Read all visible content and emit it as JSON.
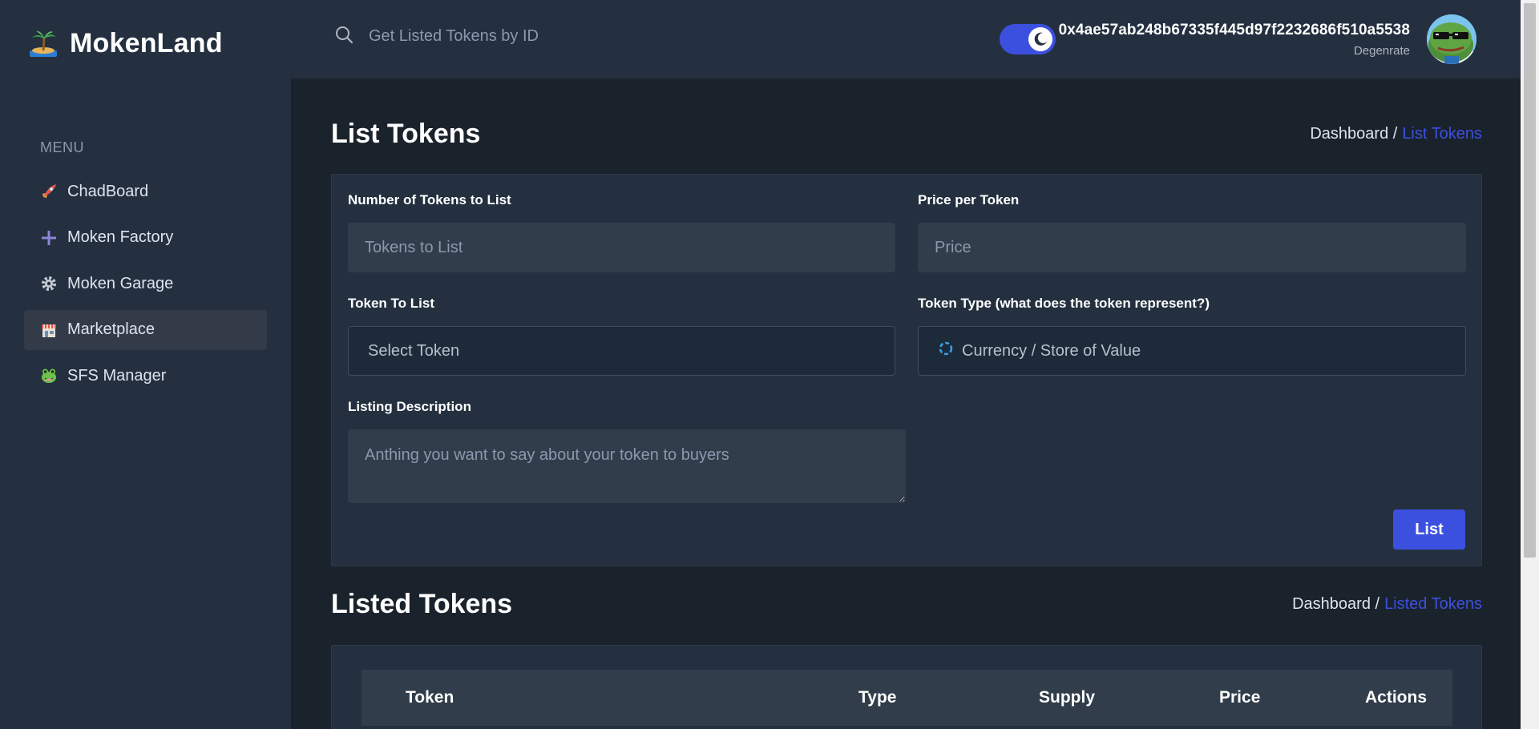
{
  "app": {
    "name": "MokenLand"
  },
  "sidebar": {
    "menu_title": "MENU",
    "items": [
      {
        "label": "ChadBoard",
        "icon": "rocket-icon",
        "active": false
      },
      {
        "label": "Moken Factory",
        "icon": "plus-icon",
        "active": false
      },
      {
        "label": "Moken Garage",
        "icon": "gear-icon",
        "active": false
      },
      {
        "label": "Marketplace",
        "icon": "shop-icon",
        "active": true
      },
      {
        "label": "SFS Manager",
        "icon": "frog-icon",
        "active": false
      }
    ]
  },
  "header": {
    "search_placeholder": "Get Listed Tokens by ID",
    "theme_toggle": "dark",
    "address": "0x4ae57ab248b67335f445d97f2232686f510a5538",
    "role": "Degenrate"
  },
  "list_tokens": {
    "title": "List Tokens",
    "breadcrumb_root": "Dashboard /",
    "breadcrumb_current": "List Tokens",
    "num_tokens_label": "Number of Tokens to List",
    "num_tokens_placeholder": "Tokens to List",
    "price_label": "Price per Token",
    "price_placeholder": "Price",
    "token_label": "Token To List",
    "token_value": "Select Token",
    "type_label": "Token Type (what does the token represent?)",
    "type_value": "Currency / Store of Value",
    "description_label": "Listing Description",
    "description_placeholder": "Anthing you want to say about your token to buyers",
    "submit_label": "List"
  },
  "listed_tokens": {
    "title": "Listed Tokens",
    "breadcrumb_root": "Dashboard /",
    "breadcrumb_current": "Listed Tokens",
    "columns": [
      "Token",
      "Type",
      "Supply",
      "Price",
      "Actions"
    ]
  },
  "colors": {
    "accent": "#3c50e0",
    "sidebar_bg": "#24303f",
    "page_bg": "#1a222c"
  }
}
